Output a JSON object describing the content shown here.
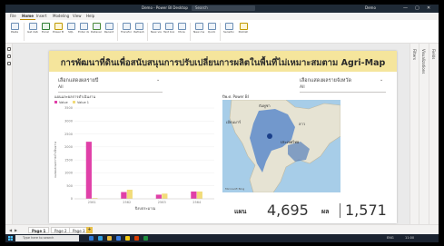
{
  "window": {
    "title": "Demo - Power BI Desktop",
    "search_placeholder": "Search",
    "user": "Demo",
    "controls": {
      "minimize": "—",
      "maximize": "▢",
      "close": "✕"
    }
  },
  "menu": {
    "tabs": [
      {
        "label": "File"
      },
      {
        "label": "Home"
      },
      {
        "label": "Insert"
      },
      {
        "label": "Modeling"
      },
      {
        "label": "View"
      },
      {
        "label": "Help"
      }
    ]
  },
  "ribbon": {
    "buttons": [
      {
        "label": "Paste",
        "icon": "paste-icon"
      },
      {
        "label": "Get data",
        "icon": "database-icon"
      },
      {
        "label": "Excel",
        "icon": "excel-icon"
      },
      {
        "label": "Power BI",
        "icon": "dataset-icon"
      },
      {
        "label": "SQL",
        "icon": "sql-icon"
      },
      {
        "label": "Enter data",
        "icon": "table-icon"
      },
      {
        "label": "Dataverse",
        "icon": "dataverse-icon"
      },
      {
        "label": "Recent",
        "icon": "recent-icon"
      },
      {
        "label": "Transform",
        "icon": "transform-icon"
      },
      {
        "label": "Refresh",
        "icon": "refresh-icon"
      },
      {
        "label": "New visual",
        "icon": "visual-icon"
      },
      {
        "label": "Text box",
        "icon": "textbox-icon"
      },
      {
        "label": "More",
        "icon": "more-visuals-icon"
      },
      {
        "label": "New measure",
        "icon": "measure-icon"
      },
      {
        "label": "Quick",
        "icon": "quick-measure-icon"
      },
      {
        "label": "Sensitivity",
        "icon": "sensitivity-icon"
      },
      {
        "label": "Publish",
        "icon": "publish-icon"
      }
    ],
    "groups": [
      "Clipboard",
      "Data",
      "Queries",
      "Insert",
      "Calculations",
      "Sensitivity",
      "Share"
    ]
  },
  "report": {
    "title": "การพัฒนาที่ดินเพื่อสนับสนุนการปรับเปลี่ยนการผลิตในพื้นที่ไม่เหมาะสมตาม Agri-Map",
    "slicer_year": {
      "label": "เลือกแสดงผลรายปี",
      "value": "All"
    },
    "slicer_province": {
      "label": "เลือกแสดงผลรายจังหวัด",
      "value": "All"
    },
    "kpi": {
      "plan_label": "แผน",
      "plan_value": "4,695",
      "result_label": "ผล",
      "result_value": "1,571"
    },
    "map": {
      "header": "ปีพ.ศ. Power BI",
      "labels": [
        "ประเทศไทย",
        "ลาว",
        "กัมพูชา",
        "เมียนมาร์"
      ],
      "footer": "Microsoft Bing"
    }
  },
  "chart_data": {
    "type": "bar",
    "title": "แผนและผลการดำเนินงาน",
    "xlabel": "ปีงบประมาณ",
    "ylabel": "แผนและผลการดำเนินงาน",
    "categories": [
      "2561",
      "2562",
      "2563",
      "2564"
    ],
    "series": [
      {
        "name": "Value",
        "color": "#e040a8",
        "values": [
          2200,
          260,
          160,
          280
        ]
      },
      {
        "name": "Value 1",
        "color": "#f2dc7a",
        "values": [
          30,
          350,
          200,
          280
        ]
      }
    ],
    "ylim": [
      0,
      3500
    ],
    "yticks": [
      "0",
      "500",
      "1000",
      "1500",
      "2000",
      "2500",
      "3000",
      "3500"
    ]
  },
  "panes": {
    "filters": "Filters",
    "visualizations": "Visualizations",
    "fields": "Fields"
  },
  "pages": {
    "tabs": [
      {
        "label": "Page 1"
      },
      {
        "label": "Page 2"
      },
      {
        "label": "Page 3"
      }
    ],
    "add": "+"
  },
  "taskbar": {
    "search_placeholder": "Type here to search",
    "clock": "11:00",
    "lang": "ENG"
  }
}
